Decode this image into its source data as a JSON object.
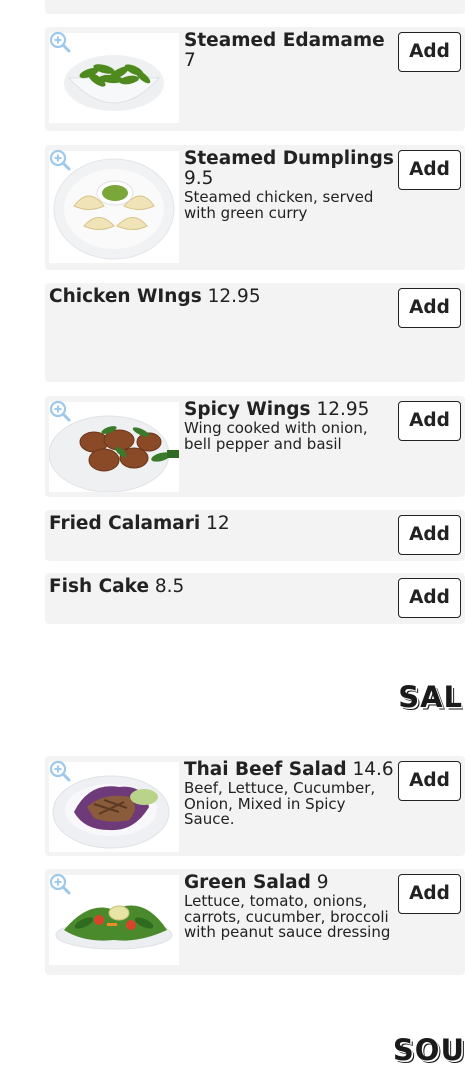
{
  "menu": {
    "add_label": "Add",
    "items": [
      {
        "name": "Steamed Edamame",
        "price": "7",
        "description": "",
        "image": "edamame"
      },
      {
        "name": "Steamed Dumplings",
        "price": "9.5",
        "description": "Steamed chicken, served with green curry",
        "image": "dumplings"
      },
      {
        "name": "Chicken WIngs",
        "price": "12.95",
        "description": "",
        "image": ""
      },
      {
        "name": "Spicy Wings",
        "price": "12.95",
        "description": "Wing cooked with onion, bell pepper and basil",
        "image": "spicy-wings"
      },
      {
        "name": "Fried Calamari",
        "price": "12",
        "description": "",
        "image": ""
      },
      {
        "name": "Fish Cake",
        "price": "8.5",
        "description": "",
        "image": ""
      },
      {
        "name": "Thai Beef Salad",
        "price": "14.6",
        "description": "Beef, Lettuce, Cucumber, Onion, Mixed in Spicy Sauce.",
        "image": "thai-beef-salad"
      },
      {
        "name": "Green Salad",
        "price": "9",
        "description": "Lettuce, tomato, onions, carrots, cucumber, broccoli with peanut sauce dressing",
        "image": "green-salad"
      }
    ]
  },
  "sections": {
    "salad": "SAL",
    "soup": "SOU"
  },
  "icons": {
    "zoom": "zoom-in-icon"
  },
  "colors": {
    "card_bg": "#f3f3f3",
    "zoom_icon": "#9ec9ea",
    "text": "#222222"
  }
}
